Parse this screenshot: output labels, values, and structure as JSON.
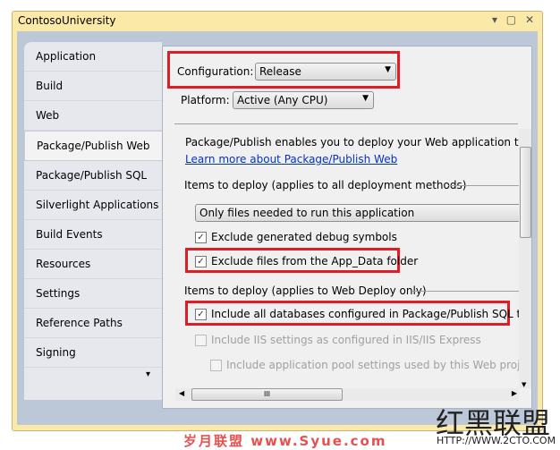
{
  "window": {
    "title": "ContosoUniversity",
    "controls": "▾ ▢ ✕"
  },
  "tabs": [
    {
      "label": "Application"
    },
    {
      "label": "Build"
    },
    {
      "label": "Web"
    },
    {
      "label": "Package/Publish Web",
      "selected": true
    },
    {
      "label": "Package/Publish SQL"
    },
    {
      "label": "Silverlight Applications"
    },
    {
      "label": "Build Events"
    },
    {
      "label": "Resources"
    },
    {
      "label": "Settings"
    },
    {
      "label": "Reference Paths"
    },
    {
      "label": "Signing"
    }
  ],
  "tabs_more": "▾",
  "config": {
    "label": "Configuration:",
    "value": "Release",
    "platform_label": "Platform:",
    "platform_value": "Active (Any CPU)"
  },
  "body": {
    "intro": "Package/Publish enables you to deploy your Web application to Web",
    "link": "Learn more about Package/Publish Web",
    "section1": "Items to deploy (applies to all deployment methods)",
    "items_combo": "Only files needed to run this application",
    "cb_debug": "Exclude generated debug symbols",
    "cb_appdata": "Exclude files from the App_Data folder",
    "section2": "Items to deploy (applies to Web Deploy only)",
    "cb_db": "Include all databases configured in Package/Publish SQL tab",
    "cb_iis": "Include IIS settings as configured in IIS/IIS Express",
    "cb_pool": "Include application pool settings used by this Web project"
  },
  "highlight_color": "#e01d25",
  "watermarks": {
    "left": "岁月联盟  www.Syue.com",
    "right_logo": "红黑联盟",
    "right_url": "HTTP://WWW.2CTO.COM"
  }
}
